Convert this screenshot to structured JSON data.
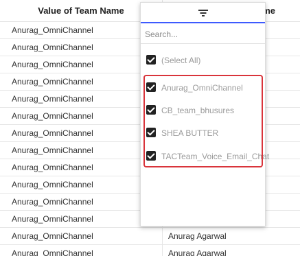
{
  "columns": {
    "col1_header": "Value of Team Name",
    "col2_header": "me"
  },
  "rows": [
    {
      "team": "Anurag_OmniChannel",
      "agent": ""
    },
    {
      "team": "Anurag_OmniChannel",
      "agent": ""
    },
    {
      "team": "Anurag_OmniChannel",
      "agent": ""
    },
    {
      "team": "Anurag_OmniChannel",
      "agent": ""
    },
    {
      "team": "Anurag_OmniChannel",
      "agent": ""
    },
    {
      "team": "Anurag_OmniChannel",
      "agent": ""
    },
    {
      "team": "Anurag_OmniChannel",
      "agent": ""
    },
    {
      "team": "Anurag_OmniChannel",
      "agent": ""
    },
    {
      "team": "Anurag_OmniChannel",
      "agent": ""
    },
    {
      "team": "Anurag_OmniChannel",
      "agent": ""
    },
    {
      "team": "Anurag_OmniChannel",
      "agent": ""
    },
    {
      "team": "Anurag_OmniChannel",
      "agent": ""
    },
    {
      "team": "Anurag_OmniChannel",
      "agent": "Anurag Agarwal"
    },
    {
      "team": "Anurag_OmniChannel",
      "agent": "Anurag Agarwal"
    }
  ],
  "filter_popup": {
    "tab_icon": "filter-lines-icon",
    "search_placeholder": "Search...",
    "select_all_label": "(Select All)",
    "options": [
      {
        "label": "Anurag_OmniChannel",
        "checked": true
      },
      {
        "label": "CB_team_bhusures",
        "checked": true
      },
      {
        "label": "SHEA BUTTER",
        "checked": true
      },
      {
        "label": "TACTeam_Voice_Email_Chat",
        "checked": true
      }
    ],
    "highlight_color": "#d9343b",
    "active_tab_color": "#3d5afe"
  }
}
